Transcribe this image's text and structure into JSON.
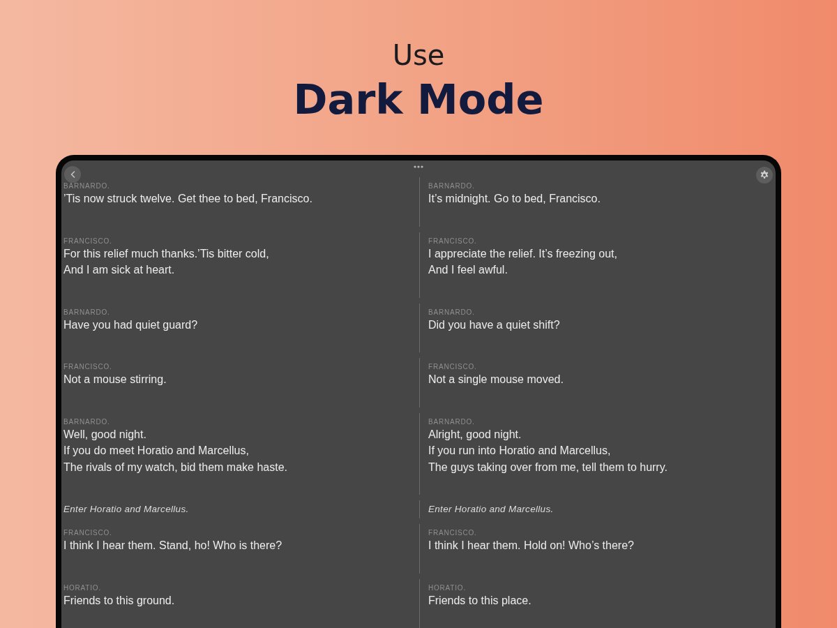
{
  "header": {
    "eyebrow": "Use",
    "title": "Dark Mode"
  },
  "passages": [
    {
      "kind": "speech",
      "original": {
        "speaker": "BARNARDO.",
        "lines": [
          "’Tis now struck twelve. Get thee to bed, Francisco."
        ]
      },
      "modern": {
        "speaker": "BARNARDO.",
        "lines": [
          "It’s midnight. Go to bed, Francisco."
        ]
      }
    },
    {
      "kind": "speech",
      "original": {
        "speaker": "FRANCISCO.",
        "lines": [
          "For this relief much thanks.’Tis bitter cold,",
          "And I am sick at heart."
        ]
      },
      "modern": {
        "speaker": "FRANCISCO.",
        "lines": [
          "I appreciate the relief. It’s freezing out,",
          "And I feel awful."
        ]
      }
    },
    {
      "kind": "speech",
      "original": {
        "speaker": "BARNARDO.",
        "lines": [
          "Have you had quiet guard?"
        ]
      },
      "modern": {
        "speaker": "BARNARDO.",
        "lines": [
          "Did you have a quiet shift?"
        ]
      }
    },
    {
      "kind": "speech",
      "original": {
        "speaker": "FRANCISCO.",
        "lines": [
          "Not a mouse stirring."
        ]
      },
      "modern": {
        "speaker": "FRANCISCO.",
        "lines": [
          "Not a single mouse moved."
        ]
      }
    },
    {
      "kind": "speech",
      "original": {
        "speaker": "BARNARDO.",
        "lines": [
          "Well, good night.",
          "If you do meet Horatio and Marcellus,",
          "The rivals of my watch, bid them make haste."
        ]
      },
      "modern": {
        "speaker": "BARNARDO.",
        "lines": [
          "Alright, good night.",
          "If you run into Horatio and Marcellus,",
          "The guys taking over from me, tell them to hurry."
        ]
      }
    },
    {
      "kind": "stage_direction",
      "original": {
        "text": "Enter Horatio and Marcellus."
      },
      "modern": {
        "text": "Enter Horatio and Marcellus."
      }
    },
    {
      "kind": "speech",
      "original": {
        "speaker": "FRANCISCO.",
        "lines": [
          "I think I hear them. Stand, ho! Who is there?"
        ]
      },
      "modern": {
        "speaker": "FRANCISCO.",
        "lines": [
          "I think I hear them. Hold on! Who’s there?"
        ]
      }
    },
    {
      "kind": "speech",
      "original": {
        "speaker": "HORATIO.",
        "lines": [
          "Friends to this ground."
        ]
      },
      "modern": {
        "speaker": "HORATIO.",
        "lines": [
          "Friends to this place."
        ]
      }
    }
  ]
}
